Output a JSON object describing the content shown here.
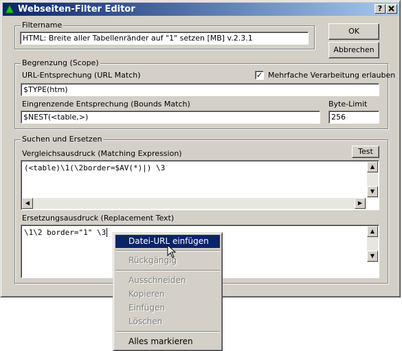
{
  "window": {
    "title": "Webseiten-Filter Editor",
    "help_label": "?",
    "close_label": "X"
  },
  "filtername": {
    "legend": "Filtername",
    "value": "HTML: Breite aller Tabellenränder auf \"1\" setzen [MB] v.2.3.1"
  },
  "buttons": {
    "ok": "OK",
    "cancel": "Abbrechen",
    "test": "Test"
  },
  "scope": {
    "legend": "Begrenzung (Scope)",
    "url_label": "URL-Entsprechung (URL Match)",
    "url_value": "$TYPE(htm)",
    "multi_label": "Mehrfache Verarbeitung erlauben",
    "multi_checked": true,
    "bounds_label": "Eingrenzende Entsprechung (Bounds Match)",
    "bounds_value": "$NEST(<table,>)",
    "bytelimit_label": "Byte-Limit",
    "bytelimit_value": "256"
  },
  "search": {
    "legend": "Suchen und Ersetzen",
    "matching_label": "Vergleichsausdruck (Matching Expression)",
    "matching_value": "(<table)\\1(\\2border=$AV(*)|) \\3",
    "replacement_label": "Ersetzungsausdruck (Replacement Text)",
    "replacement_value": "\\1\\2 border=\"1\" \\3"
  },
  "context_menu": {
    "items": [
      {
        "label": "Datei-URL einfügen",
        "state": "highlighted"
      },
      {
        "label": "Rückgängig",
        "state": "disabled"
      },
      {
        "label": "Ausschneiden",
        "state": "disabled"
      },
      {
        "label": "Kopieren",
        "state": "disabled"
      },
      {
        "label": "Einfügen",
        "state": "disabled"
      },
      {
        "label": "Löschen",
        "state": "disabled"
      },
      {
        "label": "Alles markieren",
        "state": "enabled"
      }
    ]
  },
  "colors": {
    "titlebar_start": "#0a246a",
    "titlebar_end": "#a6caf0",
    "face": "#d4d0c8",
    "highlight": "#0a246a"
  },
  "icons": {
    "app": "green-triangle-icon",
    "cursor": "mouse-pointer-icon"
  }
}
